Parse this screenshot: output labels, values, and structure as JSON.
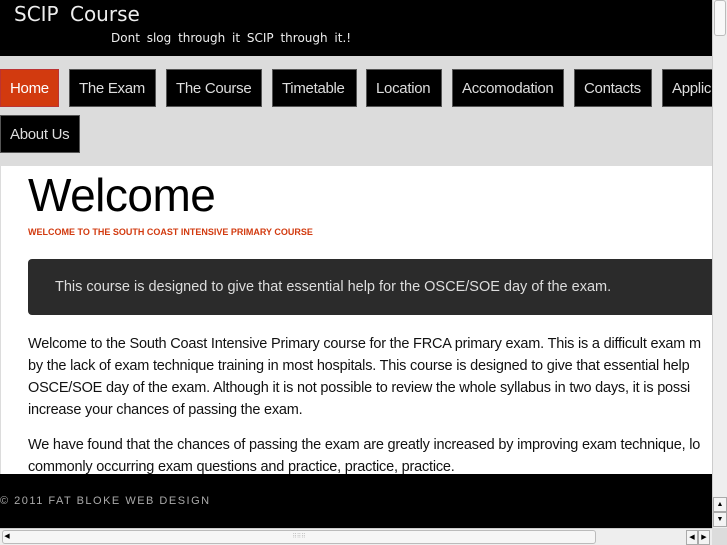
{
  "header": {
    "title": "SCIP  Course",
    "tagline": "Dont slog through it SCIP through it.!"
  },
  "nav": {
    "items": [
      {
        "label": "Home",
        "active": true
      },
      {
        "label": "The Exam"
      },
      {
        "label": "The Course"
      },
      {
        "label": "Timetable"
      },
      {
        "label": "Location"
      },
      {
        "label": "Accomodation"
      },
      {
        "label": "Contacts"
      },
      {
        "label": "Applic"
      },
      {
        "label": "About Us"
      }
    ]
  },
  "main": {
    "title": "Welcome",
    "subtitle": "WELCOME TO THE SOUTH COAST INTENSIVE PRIMARY COURSE",
    "callout": "This course is designed to give that essential help for the OSCE/SOE day of the exam.",
    "paragraph1": [
      "Welcome to the South Coast Intensive Primary course for the FRCA primary exam. This is a difficult exam m",
      "by the lack of exam technique training in most hospitals. This course is designed to give that essential help",
      "OSCE/SOE day of the exam. Although it is not possible to review the whole syllabus in two days, it is possi",
      "increase your chances of passing the exam."
    ],
    "paragraph2": [
      "We have found that the chances of passing the exam are greatly increased by improving exam technique, lo",
      "commonly occurring exam questions and practice, practice, practice."
    ]
  },
  "footer": {
    "copyright": "© 2011 FAT BLOKE WEB DESIGN"
  },
  "colors": {
    "accent": "#d23a0f",
    "header_bg": "#000000",
    "nav_bg": "#dcdcdc",
    "callout_bg": "#2b2b2b"
  },
  "scrollbars": {
    "up_icon": "▲",
    "down_icon": "▼",
    "left_icon": "◀",
    "right_icon": "▶",
    "grip": "⠿⠿⠿"
  }
}
